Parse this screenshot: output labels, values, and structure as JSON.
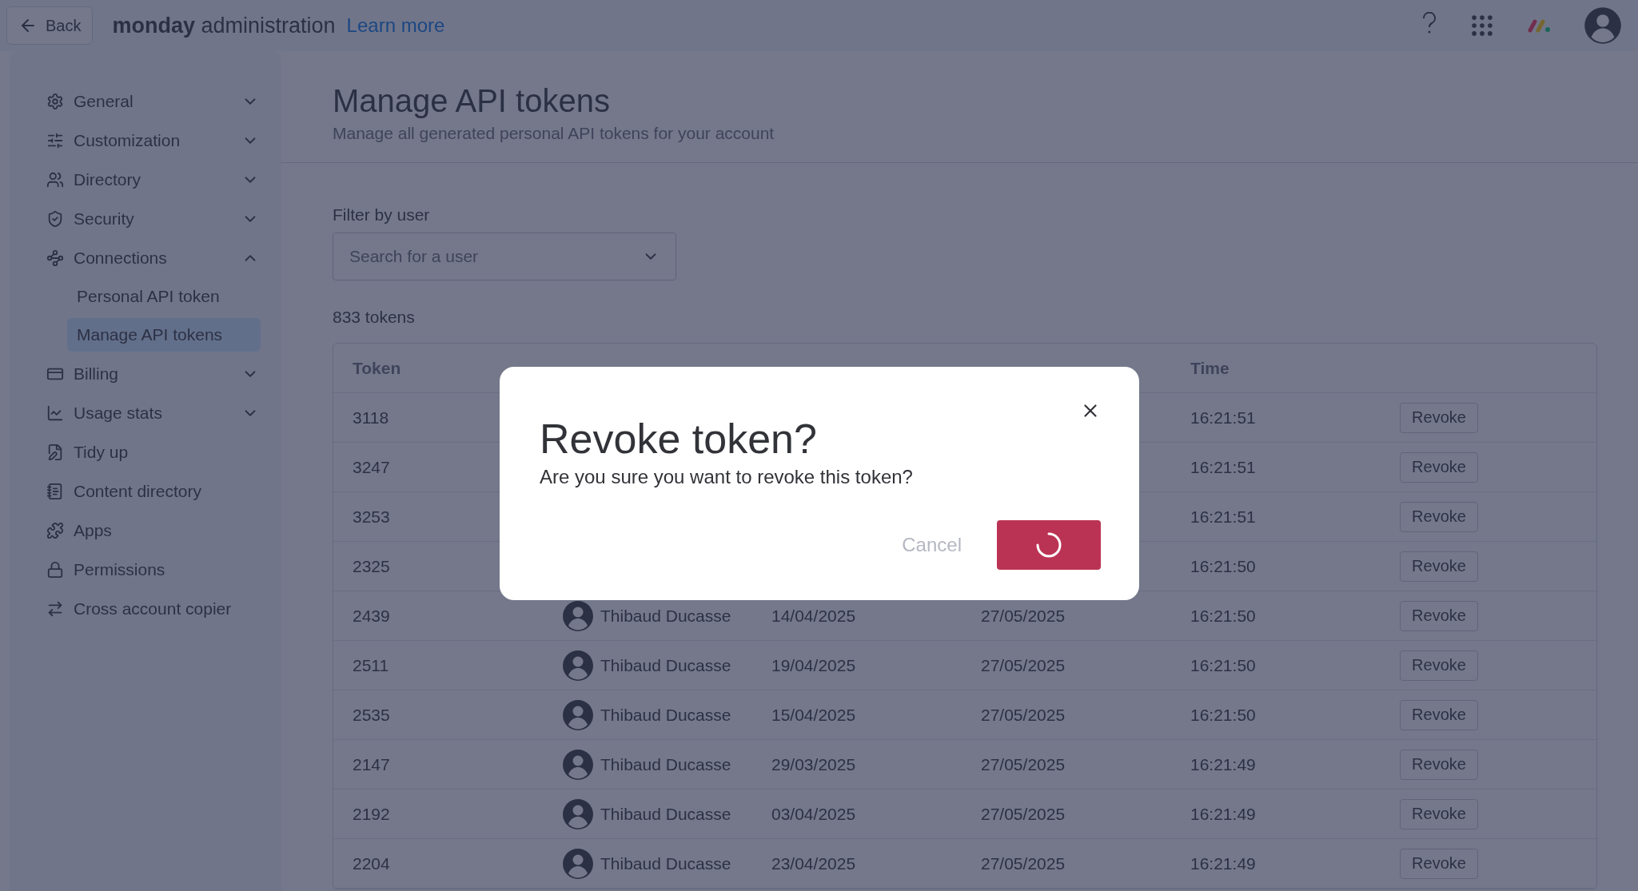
{
  "top_bar": {
    "back": "Back",
    "brand": "monday",
    "title": "administration",
    "link": "Learn more"
  },
  "sidebar": {
    "items": [
      {
        "label": "General",
        "expanded": false
      },
      {
        "label": "Customization",
        "expanded": false
      },
      {
        "label": "Directory",
        "expanded": false
      },
      {
        "label": "Security",
        "expanded": false
      },
      {
        "label": "Connections",
        "expanded": true,
        "children": [
          {
            "label": "Personal API token",
            "selected": false
          },
          {
            "label": "Manage API tokens",
            "selected": true
          }
        ]
      },
      {
        "label": "Billing",
        "expanded": false
      },
      {
        "label": "Usage stats",
        "expanded": false
      },
      {
        "label": "Tidy up"
      },
      {
        "label": "Content directory"
      },
      {
        "label": "Apps"
      },
      {
        "label": "Permissions"
      },
      {
        "label": "Cross account copier"
      }
    ]
  },
  "page": {
    "title": "Manage API tokens",
    "subtitle": "Manage all generated personal API tokens for your account",
    "filter_label": "Filter by user",
    "filter": {
      "placeholder": "Search for a user"
    },
    "count": "833 tokens"
  },
  "table": {
    "columns": [
      "Token",
      "",
      "",
      "",
      "Time",
      ""
    ],
    "rows": [
      {
        "token": "3118",
        "time": "16:21:51",
        "action": "Revoke"
      },
      {
        "token": "3247",
        "time": "16:21:51",
        "action": "Revoke"
      },
      {
        "token": "3253",
        "time": "16:21:51",
        "action": "Revoke"
      },
      {
        "token": "2325",
        "time": "16:21:50",
        "action": "Revoke"
      },
      {
        "token": "2439",
        "user": "Thibaud Ducasse",
        "created": "14/04/2025",
        "last_used": "27/05/2025",
        "time": "16:21:50",
        "action": "Revoke"
      },
      {
        "token": "2511",
        "user": "Thibaud Ducasse",
        "created": "19/04/2025",
        "last_used": "27/05/2025",
        "time": "16:21:50",
        "action": "Revoke"
      },
      {
        "token": "2535",
        "user": "Thibaud Ducasse",
        "created": "15/04/2025",
        "last_used": "27/05/2025",
        "time": "16:21:50",
        "action": "Revoke"
      },
      {
        "token": "2147",
        "user": "Thibaud Ducasse",
        "created": "29/03/2025",
        "last_used": "27/05/2025",
        "time": "16:21:49",
        "action": "Revoke"
      },
      {
        "token": "2192",
        "user": "Thibaud Ducasse",
        "created": "03/04/2025",
        "last_used": "27/05/2025",
        "time": "16:21:49",
        "action": "Revoke"
      },
      {
        "token": "2204",
        "user": "Thibaud Ducasse",
        "created": "23/04/2025",
        "last_used": "27/05/2025",
        "time": "16:21:49",
        "action": "Revoke"
      }
    ]
  },
  "dialog": {
    "title": "Revoke token?",
    "message": "Are you sure you want to revoke this token?",
    "cancel": "Cancel",
    "confirm_loading": true
  }
}
